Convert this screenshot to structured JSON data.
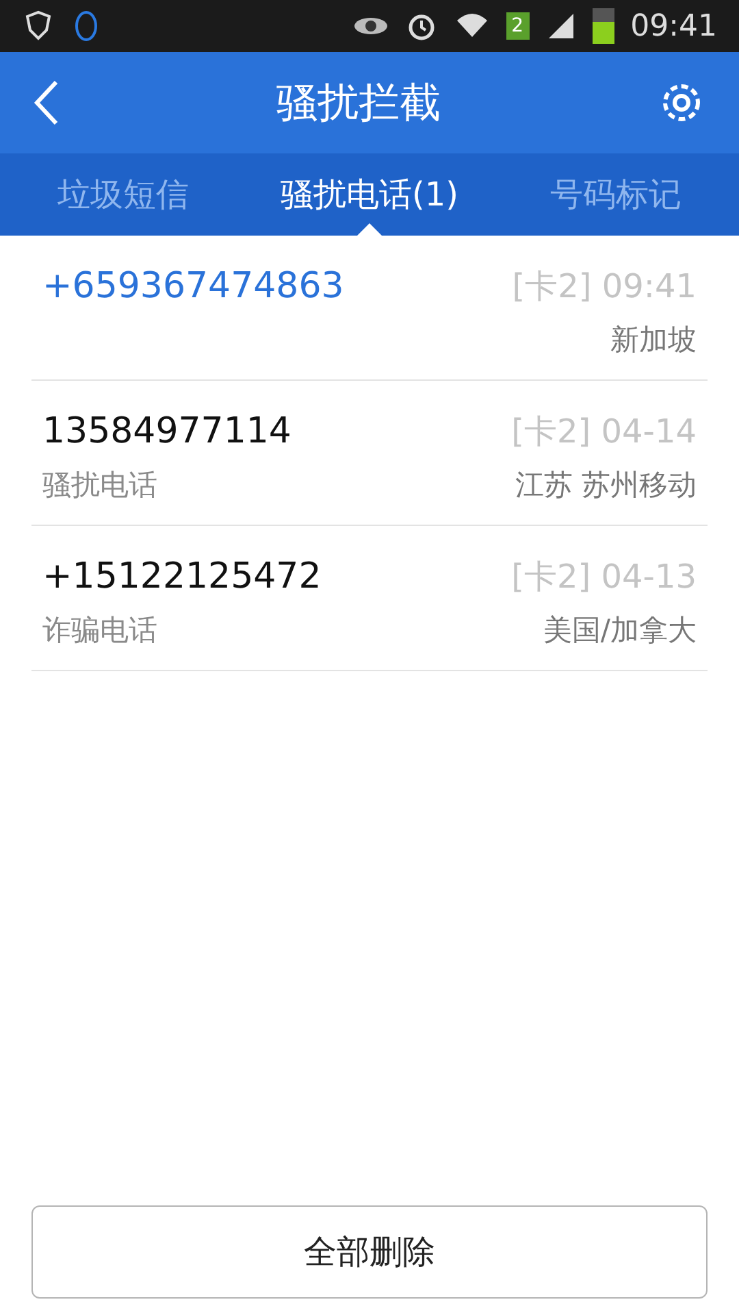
{
  "status_bar": {
    "sim_badge": "2",
    "time": "09:41"
  },
  "header": {
    "title": "骚扰拦截"
  },
  "tabs": [
    {
      "label": "垃圾短信",
      "selected": false
    },
    {
      "label": "骚扰电话(1)",
      "selected": true
    },
    {
      "label": "号码标记",
      "selected": false
    }
  ],
  "calls": [
    {
      "number": "+659367474863",
      "unread": true,
      "time": "[卡2] 09:41",
      "location": "新加坡"
    },
    {
      "number": "13584977114",
      "unread": false,
      "time": "[卡2] 04-14",
      "tag": "骚扰电话",
      "location": "江苏 苏州移动"
    },
    {
      "number": "+15122125472",
      "unread": false,
      "time": "[卡2] 04-13",
      "tag": "诈骗电话",
      "location": "美国/加拿大"
    }
  ],
  "footer": {
    "button": "全部删除"
  }
}
